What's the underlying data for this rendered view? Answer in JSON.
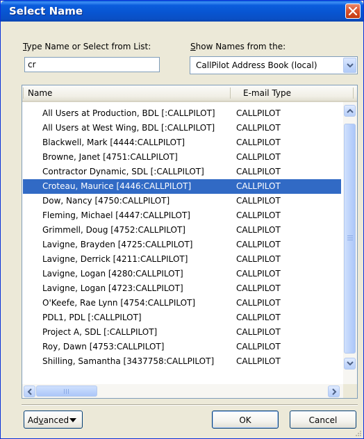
{
  "dialog": {
    "title": "Select Name"
  },
  "search": {
    "label_prefix": "",
    "label_accel": "T",
    "label_rest": "ype Name or Select from List:",
    "value": "cr"
  },
  "source": {
    "label_accel": "S",
    "label_rest": "how Names from the:",
    "selected": "CallPilot Address Book (local)"
  },
  "list": {
    "columns": [
      "Name",
      "E-mail Type"
    ],
    "selected_index": 5,
    "rows": [
      {
        "name": "All Users at Production, BDL [:CALLPILOT]",
        "type": "CALLPILOT"
      },
      {
        "name": "All Users at West Wing, BDL [:CALLPILOT]",
        "type": "CALLPILOT"
      },
      {
        "name": "Blackwell, Mark [4444:CALLPILOT]",
        "type": "CALLPILOT"
      },
      {
        "name": "Browne, Janet [4751:CALLPILOT]",
        "type": "CALLPILOT"
      },
      {
        "name": "Contractor Dynamic, SDL [:CALLPILOT]",
        "type": "CALLPILOT"
      },
      {
        "name": "Croteau, Maurice [4446:CALLPILOT]",
        "type": "CALLPILOT"
      },
      {
        "name": "Dow, Nancy [4750:CALLPILOT]",
        "type": "CALLPILOT"
      },
      {
        "name": "Fleming, Michael [4447:CALLPILOT]",
        "type": "CALLPILOT"
      },
      {
        "name": "Grimmell, Doug [4752:CALLPILOT]",
        "type": "CALLPILOT"
      },
      {
        "name": "Lavigne, Brayden [4725:CALLPILOT]",
        "type": "CALLPILOT"
      },
      {
        "name": "Lavigne, Derrick [4211:CALLPILOT]",
        "type": "CALLPILOT"
      },
      {
        "name": "Lavigne, Logan [4280:CALLPILOT]",
        "type": "CALLPILOT"
      },
      {
        "name": "Lavigne, Logan [4723:CALLPILOT]",
        "type": "CALLPILOT"
      },
      {
        "name": "O'Keefe, Rae Lynn [4754:CALLPILOT]",
        "type": "CALLPILOT"
      },
      {
        "name": "PDL1, PDL [:CALLPILOT]",
        "type": "CALLPILOT"
      },
      {
        "name": "Project A, SDL [:CALLPILOT]",
        "type": "CALLPILOT"
      },
      {
        "name": "Roy, Dawn [4753:CALLPILOT]",
        "type": "CALLPILOT"
      },
      {
        "name": "Shilling, Samantha [3437758:CALLPILOT]",
        "type": "CALLPILOT"
      }
    ]
  },
  "buttons": {
    "advanced_prefix": "Ad",
    "advanced_accel": "v",
    "advanced_rest": "anced",
    "ok": "OK",
    "cancel": "Cancel"
  },
  "icons": {
    "close": "close-icon",
    "dropdown": "chevron-down-icon",
    "scroll_up": "arrow-up-icon",
    "scroll_down": "arrow-down-icon",
    "scroll_left": "arrow-left-icon",
    "scroll_right": "arrow-right-icon",
    "resize": "resize-grip-icon"
  },
  "colors": {
    "titlebar": "#0a5ddd",
    "selection": "#316ac5",
    "close_button": "#d9532e",
    "dialog_face": "#ece9d8"
  }
}
